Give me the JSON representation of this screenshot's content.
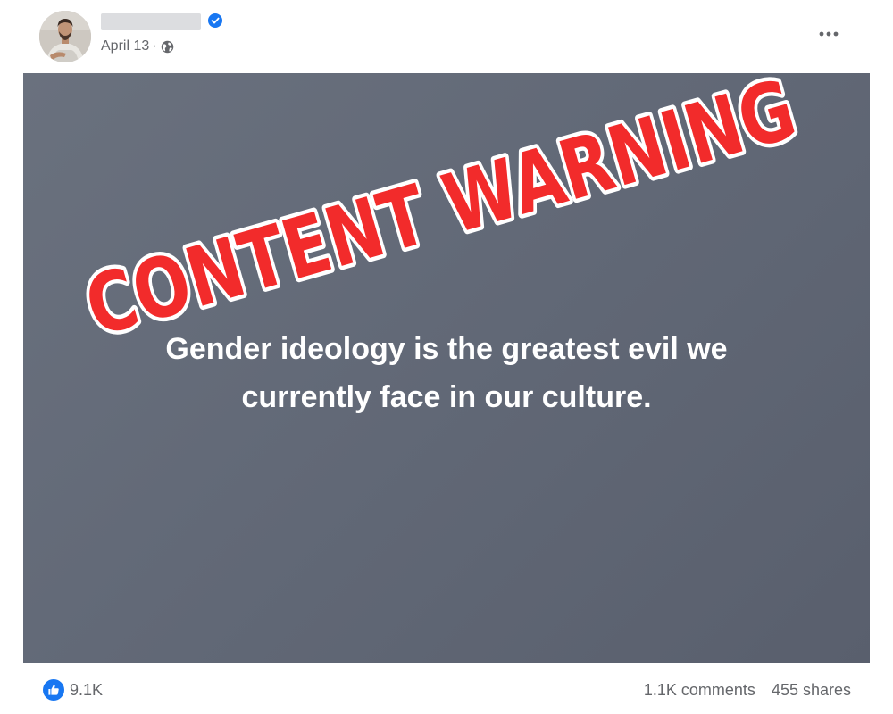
{
  "post": {
    "author": {
      "name": "",
      "verified": true,
      "avatar_icon": "avatar-photo"
    },
    "meta": {
      "date": "April 13",
      "separator": "·",
      "audience_icon": "globe-icon"
    },
    "menu_icon": "more-horizontal-icon",
    "image": {
      "overlay_text": "CONTENT WARNING",
      "text_line_1": "Gender ideology is the greatest evil we",
      "text_line_2": "currently face in our culture.",
      "overlay_color": "#f22b2b",
      "background_color": "#636a77"
    },
    "footer": {
      "reaction_icon": "like-icon",
      "reaction_count": "9.1K",
      "comments": "1.1K comments",
      "shares": "455 shares"
    }
  },
  "colors": {
    "accent": "#1877f2",
    "secondary_text": "#65676b",
    "warning_red": "#f22b2b"
  }
}
